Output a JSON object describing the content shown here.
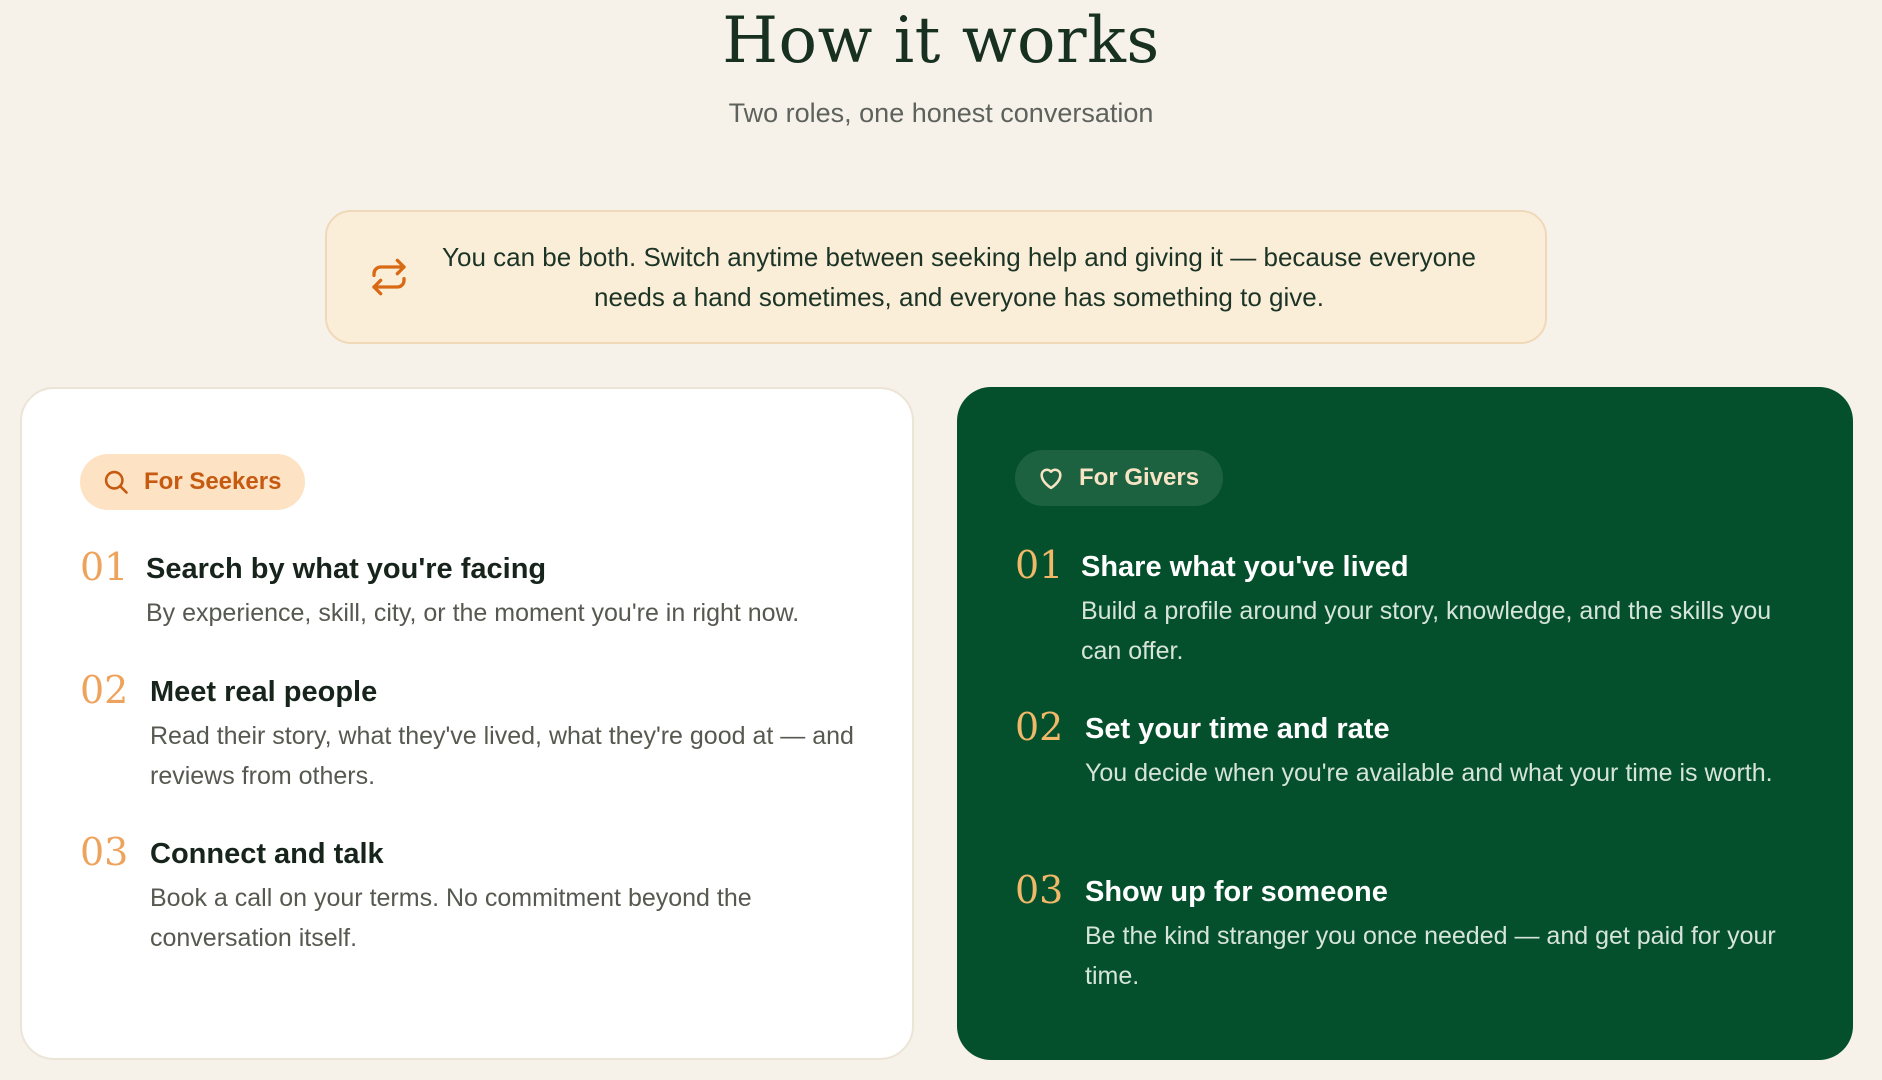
{
  "header": {
    "title": "How it works",
    "subtitle": "Two roles, one honest conversation"
  },
  "note": {
    "icon": "repeat-icon",
    "text": "You can be both. Switch anytime between seeking help and giving it — because everyone needs a hand sometimes, and everyone has something to give."
  },
  "seekers": {
    "badge_icon": "search-icon",
    "badge": "For Seekers",
    "steps": [
      {
        "num": "01",
        "title": "Search by what you're facing",
        "desc": "By experience, skill, city, or the moment you're in right now."
      },
      {
        "num": "02",
        "title": "Meet real people",
        "desc": "Read their story, what they've lived, what they're good at — and reviews from others."
      },
      {
        "num": "03",
        "title": "Connect and talk",
        "desc": "Book a call on your terms. No commitment beyond the conversation itself."
      }
    ]
  },
  "givers": {
    "badge_icon": "heart-icon",
    "badge": "For Givers",
    "steps": [
      {
        "num": "01",
        "title": "Share what you've lived",
        "desc": "Build a profile around your story, knowledge, and the skills you can offer."
      },
      {
        "num": "02",
        "title": "Set your time and rate",
        "desc": "You decide when you're available and what your time is worth."
      },
      {
        "num": "03",
        "title": "Show up for someone",
        "desc": "Be the kind stranger you once needed — and get paid for your time."
      }
    ]
  },
  "colors": {
    "background": "#f6f2ea",
    "accent_orange": "#c65a10",
    "giver_green": "#04502d",
    "number_gold": "#eda35c"
  }
}
